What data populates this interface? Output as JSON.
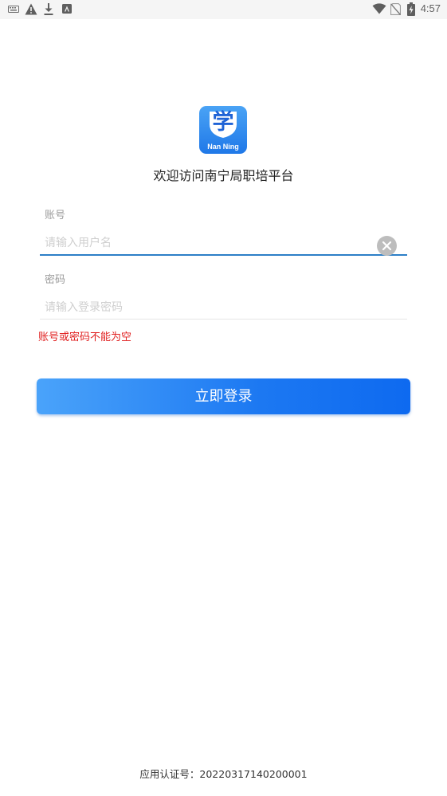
{
  "status_bar": {
    "time": "4:57",
    "left_icons": [
      "keyboard-icon",
      "warning-icon",
      "download-icon",
      "app-a-icon"
    ],
    "right_icons": [
      "wifi-icon",
      "no-sim-icon",
      "battery-charging-icon"
    ]
  },
  "logo": {
    "character": "学",
    "caption": "Nan Ning",
    "colors": {
      "bg_top": "#4aa3f5",
      "bg_bottom": "#1f78e8",
      "char": "#1f63d6"
    }
  },
  "welcome_title": "欢迎访问南宁局职培平台",
  "form": {
    "account": {
      "label": "账号",
      "value": "",
      "placeholder": "请输入用户名"
    },
    "password": {
      "label": "密码",
      "value": "",
      "placeholder": "请输入登录密码"
    },
    "error": "账号或密码不能为空",
    "submit_label": "立即登录"
  },
  "footer": {
    "certification": "应用认证号：20220317140200001"
  },
  "colors": {
    "accent": "#1c78f2",
    "underline_active": "#2c7fc7",
    "error": "#e02020"
  }
}
